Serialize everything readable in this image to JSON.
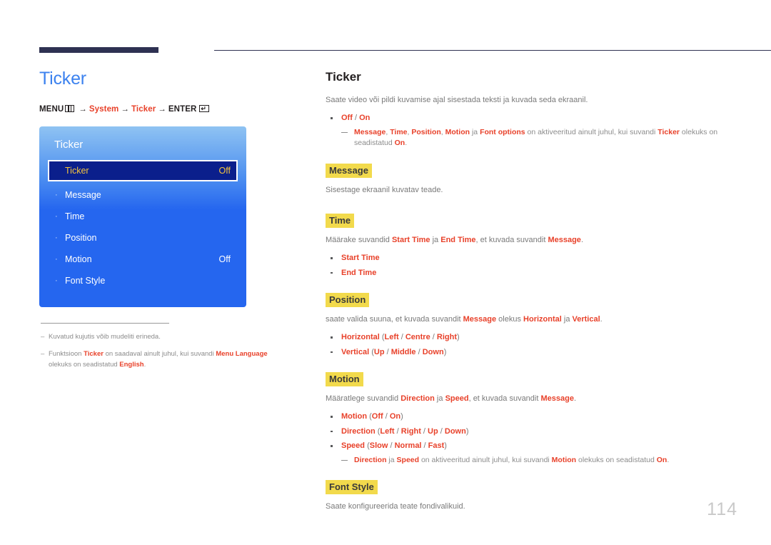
{
  "page": {
    "number": "114"
  },
  "left": {
    "title": "Ticker",
    "breadcrumb": {
      "menu_label": "MENU",
      "menu_icon": "menu-grid-icon",
      "arrow": "→",
      "item1": "System",
      "item2": "Ticker",
      "enter_label": "ENTER",
      "enter_icon": "enter-return-icon"
    },
    "osd": {
      "title": "Ticker",
      "rows": [
        {
          "bullet": "",
          "label": "Ticker",
          "value": "Off",
          "selected": true
        },
        {
          "bullet": "·",
          "label": "Message",
          "value": "",
          "selected": false
        },
        {
          "bullet": "·",
          "label": "Time",
          "value": "",
          "selected": false
        },
        {
          "bullet": "·",
          "label": "Position",
          "value": "",
          "selected": false
        },
        {
          "bullet": "·",
          "label": "Motion",
          "value": "Off",
          "selected": false
        },
        {
          "bullet": "·",
          "label": "Font Style",
          "value": "",
          "selected": false
        }
      ]
    },
    "footnotes": [
      {
        "dash": "‒",
        "parts": [
          {
            "t": "Kuvatud kujutis võib mudeliti erineda.",
            "b": false
          }
        ]
      },
      {
        "dash": "‒",
        "parts": [
          {
            "t": "Funktsioon ",
            "b": false
          },
          {
            "t": "Ticker",
            "b": true
          },
          {
            "t": " on saadaval ainult juhul, kui suvandi ",
            "b": false
          },
          {
            "t": "Menu Language",
            "b": true
          },
          {
            "t": " olekuks on seadistatud ",
            "b": false
          },
          {
            "t": "English",
            "b": true
          },
          {
            "t": ".",
            "b": false
          }
        ]
      }
    ]
  },
  "right": {
    "title": "Ticker",
    "intro": [
      {
        "t": "Saate video või pildi kuvamise ajal sisestada teksti ja kuvada seda ekraanil.",
        "b": false
      }
    ],
    "intro_bullet": [
      {
        "t": "Off",
        "b": true
      },
      {
        "t": " / ",
        "b": false
      },
      {
        "t": "On",
        "b": true
      }
    ],
    "intro_subnote": [
      {
        "t": "Message",
        "b": true
      },
      {
        "t": ", ",
        "b": false
      },
      {
        "t": "Time",
        "b": true
      },
      {
        "t": ", ",
        "b": false
      },
      {
        "t": "Position",
        "b": true
      },
      {
        "t": ", ",
        "b": false
      },
      {
        "t": "Motion",
        "b": true
      },
      {
        "t": " ja ",
        "b": false
      },
      {
        "t": "Font options",
        "b": true
      },
      {
        "t": " on aktiveeritud ainult juhul, kui suvandi ",
        "b": false
      },
      {
        "t": "Ticker",
        "b": true
      },
      {
        "t": " olekuks on seadistatud ",
        "b": false
      },
      {
        "t": "On",
        "b": true
      },
      {
        "t": ".",
        "b": false
      }
    ],
    "sections": [
      {
        "heading": "Message",
        "body": [
          {
            "t": "Sisestage ekraanil kuvatav teade.",
            "b": false
          }
        ],
        "bullets": [],
        "subnote": []
      },
      {
        "heading": "Time",
        "body": [
          {
            "t": "Määrake suvandid ",
            "b": false
          },
          {
            "t": "Start Time",
            "b": true
          },
          {
            "t": " ja ",
            "b": false
          },
          {
            "t": "End Time",
            "b": true
          },
          {
            "t": ", et kuvada suvandit ",
            "b": false
          },
          {
            "t": "Message",
            "b": true
          },
          {
            "t": ".",
            "b": false
          }
        ],
        "bullets": [
          [
            {
              "t": "Start Time",
              "b": true
            }
          ],
          [
            {
              "t": "End Time",
              "b": true
            }
          ]
        ],
        "subnote": []
      },
      {
        "heading": "Position",
        "body": [
          {
            "t": "saate valida suuna, et kuvada suvandit ",
            "b": false
          },
          {
            "t": "Message",
            "b": true
          },
          {
            "t": " olekus ",
            "b": false
          },
          {
            "t": "Horizontal",
            "b": true
          },
          {
            "t": " ja ",
            "b": false
          },
          {
            "t": "Vertical",
            "b": true
          },
          {
            "t": ".",
            "b": false
          }
        ],
        "bullets": [
          [
            {
              "t": "Horizontal",
              "b": true
            },
            {
              "t": " (",
              "b": false
            },
            {
              "t": "Left",
              "b": true
            },
            {
              "t": " / ",
              "b": false
            },
            {
              "t": "Centre",
              "b": true
            },
            {
              "t": " / ",
              "b": false
            },
            {
              "t": "Right",
              "b": true
            },
            {
              "t": ")",
              "b": false
            }
          ],
          [
            {
              "t": "Vertical",
              "b": true
            },
            {
              "t": " (",
              "b": false
            },
            {
              "t": "Up",
              "b": true
            },
            {
              "t": " / ",
              "b": false
            },
            {
              "t": "Middle",
              "b": true
            },
            {
              "t": " / ",
              "b": false
            },
            {
              "t": "Down",
              "b": true
            },
            {
              "t": ")",
              "b": false
            }
          ]
        ],
        "subnote": []
      },
      {
        "heading": "Motion",
        "body": [
          {
            "t": "Määratlege suvandid ",
            "b": false
          },
          {
            "t": "Direction",
            "b": true
          },
          {
            "t": " ja ",
            "b": false
          },
          {
            "t": "Speed",
            "b": true
          },
          {
            "t": ", et kuvada suvandit ",
            "b": false
          },
          {
            "t": "Message",
            "b": true
          },
          {
            "t": ".",
            "b": false
          }
        ],
        "bullets": [
          [
            {
              "t": "Motion",
              "b": true
            },
            {
              "t": " (",
              "b": false
            },
            {
              "t": "Off",
              "b": true
            },
            {
              "t": " / ",
              "b": false
            },
            {
              "t": "On",
              "b": true
            },
            {
              "t": ")",
              "b": false
            }
          ],
          [
            {
              "t": "Direction",
              "b": true
            },
            {
              "t": " (",
              "b": false
            },
            {
              "t": "Left",
              "b": true
            },
            {
              "t": " / ",
              "b": false
            },
            {
              "t": "Right",
              "b": true
            },
            {
              "t": " / ",
              "b": false
            },
            {
              "t": "Up",
              "b": true
            },
            {
              "t": " / ",
              "b": false
            },
            {
              "t": "Down",
              "b": true
            },
            {
              "t": ")",
              "b": false
            }
          ],
          [
            {
              "t": "Speed",
              "b": true
            },
            {
              "t": " (",
              "b": false
            },
            {
              "t": "Slow",
              "b": true
            },
            {
              "t": " / ",
              "b": false
            },
            {
              "t": "Normal",
              "b": true
            },
            {
              "t": " / ",
              "b": false
            },
            {
              "t": "Fast",
              "b": true
            },
            {
              "t": ")",
              "b": false
            }
          ]
        ],
        "subnote": [
          {
            "t": "Direction",
            "b": true
          },
          {
            "t": " ja ",
            "b": false
          },
          {
            "t": "Speed",
            "b": true
          },
          {
            "t": " on aktiveeritud ainult juhul, kui suvandi ",
            "b": false
          },
          {
            "t": "Motion",
            "b": true
          },
          {
            "t": " olekuks on seadistatud ",
            "b": false
          },
          {
            "t": "On",
            "b": true
          },
          {
            "t": ".",
            "b": false
          }
        ]
      },
      {
        "heading": "Font Style",
        "body": [
          {
            "t": "Saate konfigureerida teate fondivalikuid.",
            "b": false
          }
        ],
        "bullets": [],
        "subnote": []
      }
    ]
  },
  "colors": {
    "accent_red": "#e8412a",
    "heading_blue": "#3c82ef",
    "highlight_yellow": "#f2da4c",
    "osd_blue": "#2566ef",
    "osd_selected": "#0b1f8c",
    "osd_selected_text": "#f5c43d",
    "rule_navy": "#2e3152"
  }
}
